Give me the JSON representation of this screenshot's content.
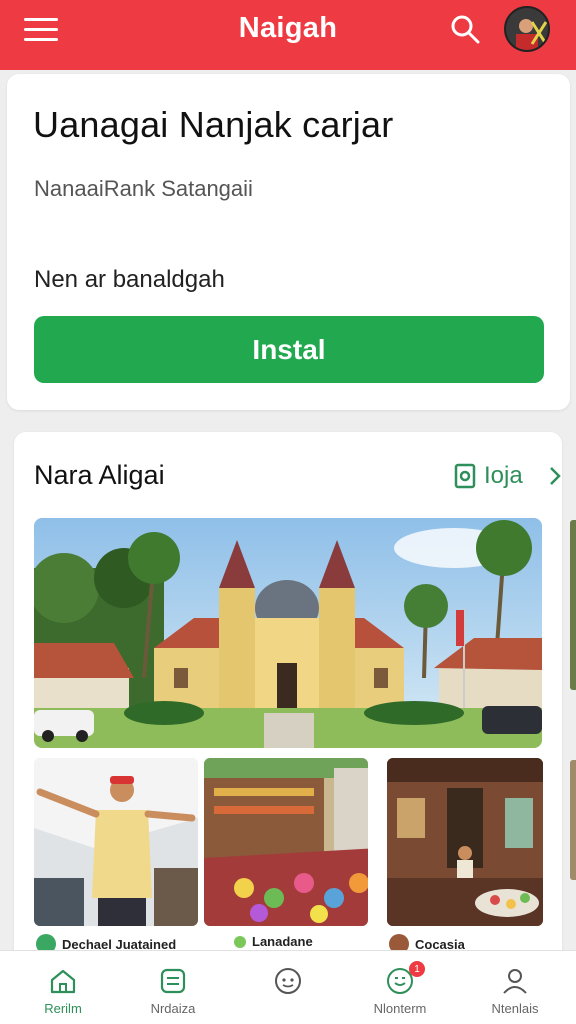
{
  "header": {
    "title": "Naigah",
    "menu_icon": "hamburger-menu-icon",
    "search_icon": "search-icon",
    "avatar": "user-avatar"
  },
  "install_card": {
    "title": "Uanagai Nanjak carjar",
    "subtitle": "NanaaiRank Satangaii",
    "detail": "Nen ar banaldgah",
    "button_label": "Instal"
  },
  "gallery": {
    "title": "Nara Aligai",
    "link_label": "Ioja",
    "captions": [
      "Dechael Juatained",
      "Lanadane",
      "Cocasia"
    ]
  },
  "bottom_nav": {
    "items": [
      {
        "label": "Rerilm",
        "icon": "home-icon"
      },
      {
        "label": "Nrdaiza",
        "icon": "ticket-icon"
      },
      {
        "label": "",
        "icon": "chat-face-icon"
      },
      {
        "label": "Nlonterm",
        "icon": "smile-bubble-icon",
        "badge": "1"
      },
      {
        "label": "Ntenlais",
        "icon": "person-icon"
      }
    ]
  },
  "colors": {
    "brand_red": "#ee3b43",
    "install_green": "#22a94f",
    "link_green": "#2e8f5a"
  }
}
